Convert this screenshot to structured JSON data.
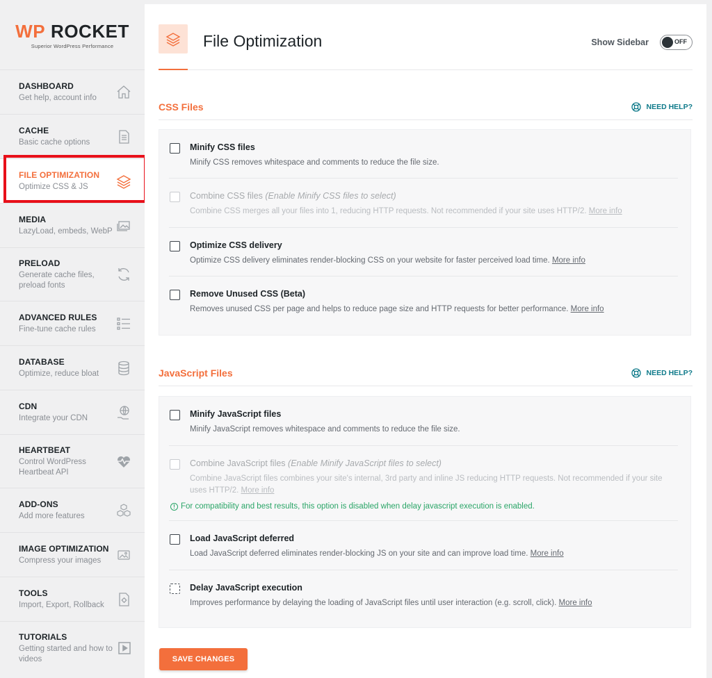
{
  "logo": {
    "wp": "WP",
    "rocket": "ROCKET",
    "tagline": "Superior WordPress Performance"
  },
  "sidebar": {
    "items": [
      {
        "title": "DASHBOARD",
        "sub": "Get help, account info",
        "icon": "home-icon"
      },
      {
        "title": "CACHE",
        "sub": "Basic cache options",
        "icon": "document-icon"
      },
      {
        "title": "FILE OPTIMIZATION",
        "sub": "Optimize CSS & JS",
        "icon": "layers-icon",
        "active": true
      },
      {
        "title": "MEDIA",
        "sub": "LazyLoad, embeds, WebP",
        "icon": "images-icon"
      },
      {
        "title": "PRELOAD",
        "sub": "Generate cache files, preload fonts",
        "icon": "refresh-icon"
      },
      {
        "title": "ADVANCED RULES",
        "sub": "Fine-tune cache rules",
        "icon": "list-icon"
      },
      {
        "title": "DATABASE",
        "sub": "Optimize, reduce bloat",
        "icon": "database-icon"
      },
      {
        "title": "CDN",
        "sub": "Integrate your CDN",
        "icon": "globe-hand-icon"
      },
      {
        "title": "HEARTBEAT",
        "sub": "Control WordPress Heartbeat API",
        "icon": "heartbeat-icon"
      },
      {
        "title": "ADD-ONS",
        "sub": "Add more features",
        "icon": "cubes-icon"
      },
      {
        "title": "IMAGE OPTIMIZATION",
        "sub": "Compress your images",
        "icon": "image-compress-icon"
      },
      {
        "title": "TOOLS",
        "sub": "Import, Export, Rollback",
        "icon": "tools-icon"
      },
      {
        "title": "TUTORIALS",
        "sub": "Getting started and how to videos",
        "icon": "video-icon"
      }
    ]
  },
  "header": {
    "title": "File Optimization",
    "show_sidebar_label": "Show Sidebar",
    "toggle_state": "OFF"
  },
  "css_section": {
    "title": "CSS Files",
    "help": "NEED HELP?",
    "options": [
      {
        "title": "Minify CSS files",
        "desc": "Minify CSS removes whitespace and comments to reduce the file size."
      },
      {
        "title": "Combine CSS files",
        "hint": "(Enable Minify CSS files to select)",
        "desc": "Combine CSS merges all your files into 1, reducing HTTP requests. Not recommended if your site uses HTTP/2.",
        "more": "More info"
      },
      {
        "title": "Optimize CSS delivery",
        "desc": "Optimize CSS delivery eliminates render-blocking CSS on your website for faster perceived load time.",
        "more": "More info"
      },
      {
        "title": "Remove Unused CSS (Beta)",
        "desc": "Removes unused CSS per page and helps to reduce page size and HTTP requests for better performance.",
        "more": "More info"
      }
    ]
  },
  "js_section": {
    "title": "JavaScript Files",
    "help": "NEED HELP?",
    "options": [
      {
        "title": "Minify JavaScript files",
        "desc": "Minify JavaScript removes whitespace and comments to reduce the file size."
      },
      {
        "title": "Combine JavaScript files",
        "hint": "(Enable Minify JavaScript files to select)",
        "desc": "Combine JavaScript files combines your site's internal, 3rd party and inline JS reducing HTTP requests. Not recommended if your site uses HTTP/2.",
        "more": "More info",
        "notice": "For compatibility and best results, this option is disabled when delay javascript execution is enabled."
      },
      {
        "title": "Load JavaScript deferred",
        "desc": "Load JavaScript deferred eliminates render-blocking JS on your site and can improve load time.",
        "more": "More info"
      },
      {
        "title": "Delay JavaScript execution",
        "desc": "Improves performance by delaying the loading of JavaScript files until user interaction (e.g. scroll, click).",
        "more": "More info"
      }
    ]
  },
  "save_button": "SAVE CHANGES",
  "colors": {
    "accent": "#f36f3c",
    "help": "#0e7a8a",
    "notice": "#2aa567",
    "highlight_frame": "#e8101a"
  }
}
